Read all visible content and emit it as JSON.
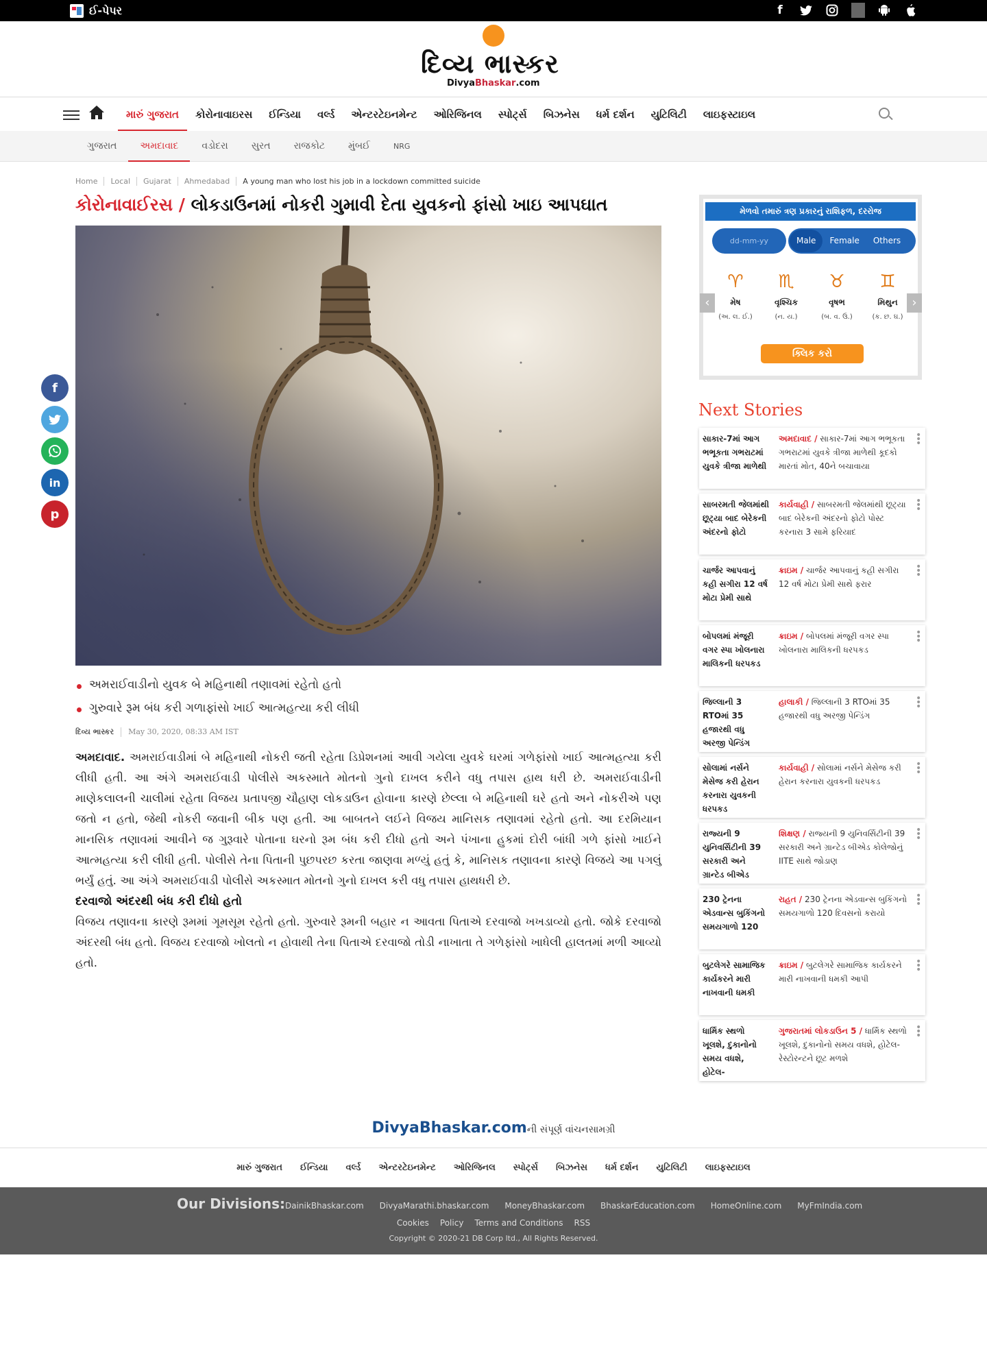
{
  "topbar": {
    "epaper": "ઈ-પેપર",
    "social": [
      "f",
      "t",
      "ig",
      "android",
      "apple"
    ]
  },
  "logo": {
    "text": "દિવ્ય ભાસ્કર",
    "sub_pre": "Divya",
    "sub_brand": "Bhaskar",
    "sub_post": ".com"
  },
  "nav": {
    "items": [
      "મારું ગુજરાત",
      "કોરોનાવાઇરસ",
      "ઈન્ડિયા",
      "વર્લ્ડ",
      "એન્ટરટેઇનમેન્ટ",
      "ઓરિજિનલ",
      "સ્પોર્ટ્સ",
      "બિઝનેસ",
      "ધર્મ દર્શન",
      "યુટિલિટી",
      "લાઇફસ્ટાઇલ"
    ]
  },
  "subnav": {
    "items": [
      "ગુજરાત",
      "અમદાવાદ",
      "વડોદરા",
      "સુરત",
      "રાજકોટ",
      "મુંબઈ",
      "NRG"
    ]
  },
  "breadcrumb": [
    "Home",
    "Local",
    "Gujarat",
    "Ahmedabad",
    "A young man who lost his job in a lockdown committed suicide"
  ],
  "article": {
    "kicker": "કોરોનાવાઈરસ /",
    "title": "લોકડાઉનમાં નોકરી ગુમાવી દેતા યુવકનો ફાંસો ખાઇ આપઘાત",
    "bullets": [
      "અમરાઈવાડીનો યુવક બે મહિનાથી તણાવમાં રહેતો હતો",
      "ગુરુવારે રૂમ બંધ કરી ગળાફાંસો ખાઈ આત્મહત્યા કરી લીધી"
    ],
    "source": "દિવ્ય ભાસ્કર",
    "date": "May 30, 2020, 08:33 AM IST",
    "lead": "અમદાવાદ.",
    "para1": "અમરાઈવાડીમાં બે મહિનાથી નોકરી જતી રહેતા ડિપ્રેશનમાં આવી ગયેલા યુવકે ઘરમાં ગળેફાંસો ખાઈ આત્મહત્યા કરી લીધી હતી. આ અંગે અમરાઈવાડી પોલીસે અકસ્માતે મોતનો ગુનો દાખલ કરીને વધુ તપાસ હાથ ધરી છે. અમરાઈવાડીની માણેકલાલની ચાલીમાં રહેતા વિજય પ્રતાપજી ચૌહાણ લોકડાઉન હોવાના કારણે છેલ્લા બે મહિનાથી ઘરે હતો અને નોકરીએ પણ જતો ન હતો, જેથી નોકરી જવાની બીક પણ હતી. આ બાબતને લઈને વિજય માનિસક તણાવમાં રહેતો હતો. આ દરમિયાન માનસિક તણાવમાં આવીને જ ગુરૂવારે પોતાના ઘરનો રૂમ બંધ કરી દીધો હતો અને પંખાના હુકમાં દોરી બાંધી ગળે ફાંસો ખાઈને આત્મહત્યા કરી લીધી હતી. પોલીસે તેના પિતાની પુછપરછ કરતા જાણવા મળ્યું હતું કે, માનિસક તણાવના કારણે વિજયે આ પગલું ભર્યું હતું. આ અંગે અમરાઈવાડી પોલીસે અકસ્માત મોતનો ગુનો દાખલ કરી વધુ તપાસ હાથધરી છે.",
    "subhead": "દરવાજો અંદરથી બંધ કરી દીધો હતો",
    "para2": "વિજય તણાવના કારણે રૂમમાં ગૂમસૂમ રહેતો હતો. ગુરુવારે રૂમની બહાર ન આવતા પિતાએ દરવાજો ખખડાવ્યો હતો. જોકે દરવાજો અંદરથી બંધ હતો. વિજય દરવાજો ખોલતો ન હોવાથી તેના પિતાએ દરવાજો તોડી નાખાતા તે ગળેફાંસો ખાધેલી હાલતમાં મળી આવ્યો હતો."
  },
  "share": [
    {
      "icon": "f",
      "color": "#3b5998"
    },
    {
      "icon": "t",
      "color": "#4fa6df"
    },
    {
      "icon": "w",
      "color": "#25b35a"
    },
    {
      "icon": "in",
      "color": "#1d66b0"
    },
    {
      "icon": "p",
      "color": "#c8232c"
    }
  ],
  "rashi": {
    "header": "મેળવો તમારું ત્રણ પ્રકારનું રાશિફળ, દરરોજ",
    "date_placeholder": "dd-mm-yy",
    "genders": [
      "Male",
      "Female",
      "Others"
    ],
    "signs": [
      {
        "name": "મેષ",
        "letters": "(અ. લ. ઈ.)",
        "icon": "ram-icon"
      },
      {
        "name": "વૃશ્ચિક",
        "letters": "(ન. ય.)",
        "icon": "scorpion-icon"
      },
      {
        "name": "વૃષભ",
        "letters": "(બ. વ. ઉ.)",
        "icon": "bull-icon"
      },
      {
        "name": "મિથુન",
        "letters": "(ક. છ. ઘ.)",
        "icon": "twins-icon"
      }
    ],
    "button": "ક્લિક કરો"
  },
  "next_stories": {
    "title": "Next Stories",
    "items": [
      {
        "thumb": "સાકાર-7માં આગ ભભૂકતા ગભરાટમાં યુવકે ત્રીજા માળેથી",
        "cat": "અમદાવાદ /",
        "text": "સાકાર-7માં આગ ભભૂકતા ગભરાટમાં યુવકે ત્રીજા માળેથી કૂદકો મારતાં મોત, 40ને બચાવાયા"
      },
      {
        "thumb": "સાબરમતી જેલમાંથી છૂટ્યા બાદ બેરેકની અંદરનો ફોટો",
        "cat": "કાર્યવાહી /",
        "text": "સાબરમતી જેલમાંથી છૂટ્યા બાદ બેરેકની અંદરનો ફોટો પોસ્ટ કરનારા 3 સામે ફરિયાદ"
      },
      {
        "thumb": "ચાર્જર આપવાનું કહી સગીરા 12 વર્ષ મોટા પ્રેમી સાથે",
        "cat": "ક્રાઇમ /",
        "text": "ચાર્જર આપવાનું કહી સગીરા 12 વર્ષ મોટા પ્રેમી સાથે ફરાર"
      },
      {
        "thumb": "બોપલમાં મંજૂરી વગર સ્પા ખોલનારા માલિકની ધરપકડ",
        "cat": "ક્રાઇમ /",
        "text": "બોપલમાં મંજૂરી વગર સ્પા ખોલનારા માલિકની ધરપકડ"
      },
      {
        "thumb": "જિલ્લાની 3 RTOમાં 35 હજારથી વધુ અરજી પેન્ડિંગ",
        "cat": "હાલાકી /",
        "text": "જિલ્લાની 3 RTOમાં 35 હજારથી વધુ અરજી પેન્ડિંગ"
      },
      {
        "thumb": "સોલામાં નર્સને મેસેજ કરી હેરાન કરનારા યુવકની ધરપકડ",
        "cat": "કાર્યવાહી /",
        "text": "સોલામાં નર્સને મેસેજ કરી હેરાન કરનારા યુવકની ધરપકડ"
      },
      {
        "thumb": "રાજ્યની 9 યુનિવર્સિટીની 39 સરકારી અને ગ્રાન્ટેડ બીએડ",
        "cat": "શિક્ષણ /",
        "text": "રાજ્યની 9 યુનિવર્સિટીની 39 સરકારી અને ગ્રાન્ટેડ બીએડ કોલેજોનું IITE સાથે જોડાણ"
      },
      {
        "thumb": "230 ટ્રેનના એડવાન્સ બુકિંગનો સમયગાળો 120",
        "cat": "રાહત /",
        "text": "230 ટ્રેનના એડવાન્સ બુકિંગનો સમયગાળો 120 દિવસનો કરાયો"
      },
      {
        "thumb": "બુટલેગરે સામાજિક કાર્યકરને મારી નાખવાની ધમકી",
        "cat": "ક્રાઇમ /",
        "text": "બુટલેગરે સામાજિક કાર્યકરને મારી નાખવાની ધમકી આપી"
      },
      {
        "thumb": "ધાર્મિક સ્થળો ખૂલશે, દુકાનોનો સમય વધશે, હોટેલ-",
        "cat": "ગુજરાતમાં લોકડાઉન 5 /",
        "text": "ધાર્મિક સ્થળો ખૂલશે, દુકાનોનો સમય વધશે, હોટેલ-રેસ્ટોરન્ટને છૂટ મળશે"
      }
    ]
  },
  "footer": {
    "brand": "DivyaBhaskar.com",
    "brand_suffix": "ની સંપૂર્ણ વાંચનસામગ્રી",
    "links": [
      "મારું ગુજરાત",
      "ઈન્ડિયા",
      "વર્લ્ડ",
      "એન્ટરટેઇનમેન્ટ",
      "ઓરિજિનલ",
      "સ્પોર્ટ્સ",
      "બિઝનેસ",
      "ધર્મ દર્શન",
      "યુટિલિટી",
      "લાઇફસ્ટાઇલ"
    ],
    "divisions_label": "Our Divisions:",
    "divisions": [
      "DainikBhaskar.com",
      "DivyaMarathi.bhaskar.com",
      "MoneyBhaskar.com",
      "BhaskarEducation.com",
      "HomeOnline.com",
      "MyFmIndia.com"
    ],
    "legal": [
      "Cookies",
      "Policy",
      "Terms and Conditions",
      "RSS"
    ],
    "copyright": "Copyright © 2020-21 DB Corp ltd., All Rights Reserved."
  },
  "colors": {
    "accent": "#d7262f",
    "rashi_blue": "#1c6ec2",
    "rashi_orange": "#f7931e",
    "footer_dark": "#5a5a5a"
  }
}
